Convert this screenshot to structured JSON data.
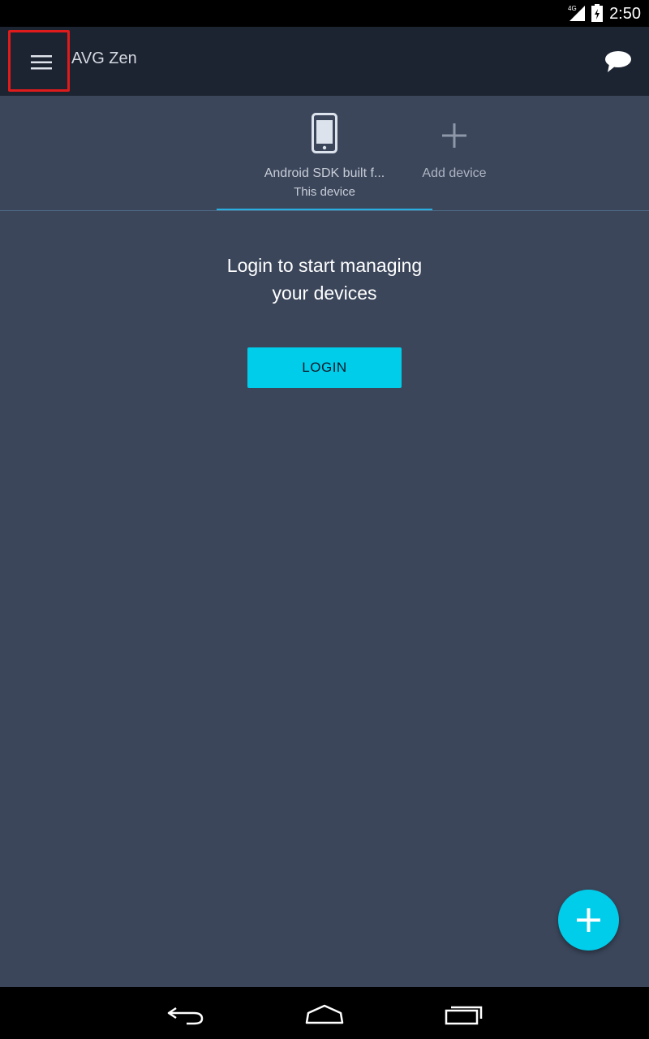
{
  "status_bar": {
    "network": "4G",
    "time": "2:50"
  },
  "app_bar": {
    "title": "AVG Zen",
    "menu_icon": "hamburger-menu-icon",
    "chat_icon": "chat-bubble-icon"
  },
  "devices": {
    "tabs": [
      {
        "name": "Android SDK built f...",
        "subtitle": "This device",
        "icon": "phone-icon",
        "selected": true
      },
      {
        "name": "Add device",
        "icon": "plus-icon",
        "selected": false
      }
    ]
  },
  "main": {
    "message_line1": "Login to start managing",
    "message_line2": "your devices",
    "login_label": "LOGIN"
  },
  "fab": {
    "icon": "plus-icon"
  },
  "colors": {
    "background": "#3b465b",
    "app_bar": "#1c2331",
    "accent": "#00cdea",
    "tab_indicator": "#2aaedf",
    "highlight_box": "#e01b1b"
  }
}
